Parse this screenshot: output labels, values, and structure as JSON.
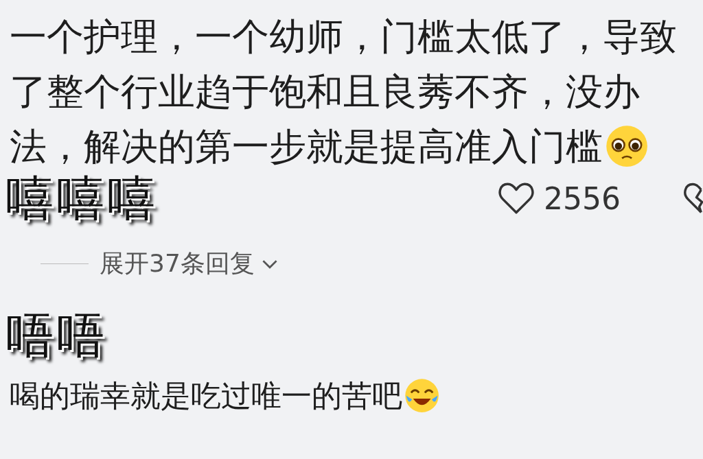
{
  "comments": [
    {
      "text": "一个护理，一个幼师，门槛太低了，导致了整个行业趋于饱和且良莠不齐，没办法，解决的第一步就是提高准入门槛",
      "emoji": {
        "kind": "pleading"
      },
      "sticker": "嘻嘻嘻",
      "like_count": "2556",
      "reply_toggle": "展开37条回复"
    },
    {
      "text": "喝的瑞幸就是吃过唯一的苦吧",
      "emoji": {
        "kind": "laughing"
      },
      "sticker": "唔唔"
    }
  ]
}
